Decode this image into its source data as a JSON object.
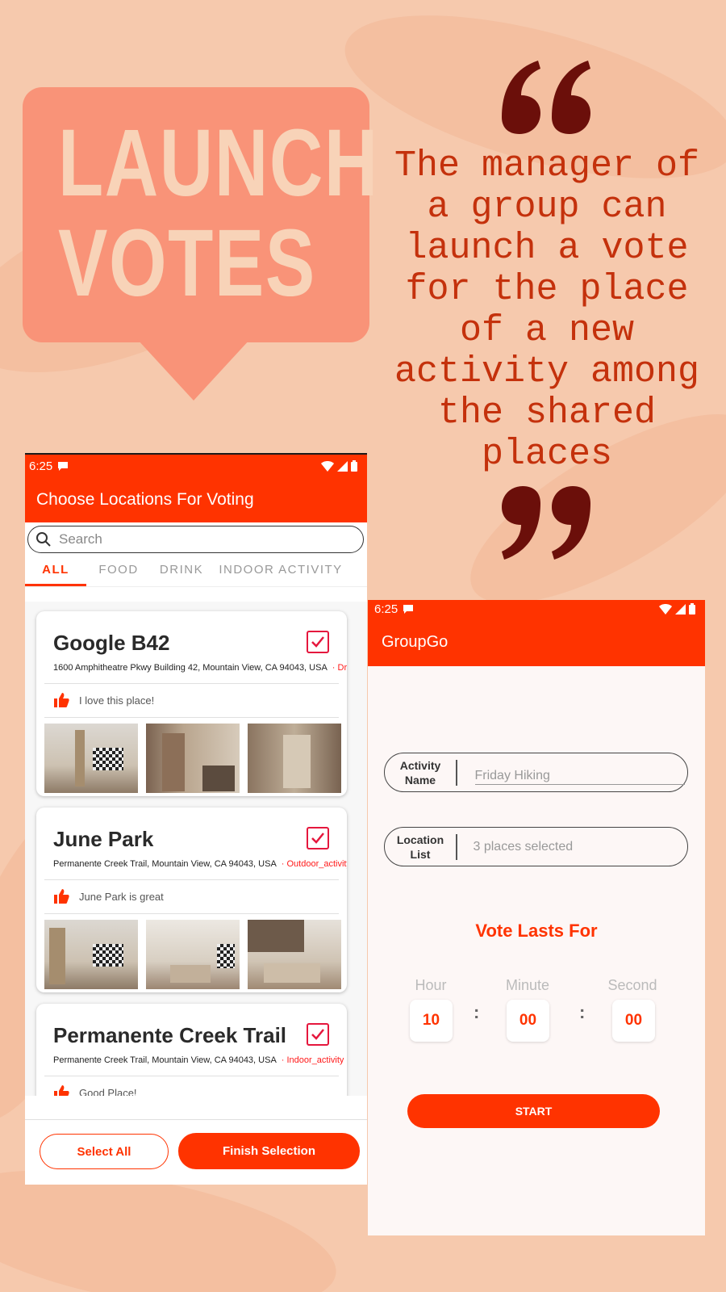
{
  "promo": {
    "bubble_line1": "LAUNCH",
    "bubble_line2": "VOTES",
    "quote": "The manager of a group can launch a vote for the place of a new activity among the shared places"
  },
  "colors": {
    "accent": "#ff3300",
    "background": "#f6c9ad",
    "bubble": "#f99378",
    "quote_text": "#c4310c",
    "quote_mark": "#6b0f0a"
  },
  "phone1": {
    "status_time": "6:25",
    "title": "Choose Locations For Voting",
    "search_placeholder": "Search",
    "tabs": [
      "ALL",
      "FOOD",
      "DRINK",
      "INDOOR ACTIVITY"
    ],
    "cards": [
      {
        "name": "Google B42",
        "address": "1600 Amphitheatre Pkwy Building 42, Mountain View, CA 94043, USA",
        "tag": "· Drin",
        "comment": "I love this place!",
        "checked": true
      },
      {
        "name": "June Park",
        "address": "Permanente Creek Trail, Mountain View, CA 94043, USA",
        "tag": "· Outdoor_activity",
        "comment": "June Park is great",
        "checked": true
      },
      {
        "name": "Permanente Creek Trail",
        "address": "Permanente Creek Trail, Mountain View, CA 94043, USA",
        "tag": "· Indoor_activity",
        "comment": "Good Place!",
        "checked": true
      }
    ],
    "select_all": "Select All",
    "finish_selection": "Finish Selection"
  },
  "phone2": {
    "status_time": "6:25",
    "title": "GroupGo",
    "activity_label_1": "Activity",
    "activity_label_2": "Name",
    "activity_value": "Friday Hiking",
    "location_label_1": "Location",
    "location_label_2": "List",
    "location_value": "3 places selected",
    "vote_title": "Vote Lasts For",
    "hour_label": "Hour",
    "minute_label": "Minute",
    "second_label": "Second",
    "hour_value": "10",
    "minute_value": "00",
    "second_value": "00",
    "colon": ":",
    "start": "START"
  }
}
